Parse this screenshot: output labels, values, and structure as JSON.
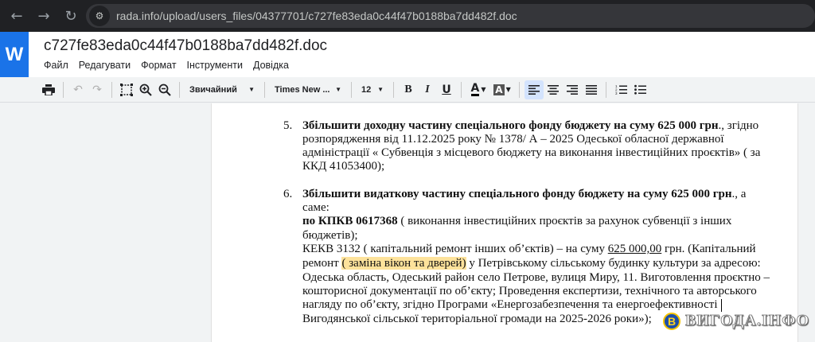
{
  "browser": {
    "back_icon": "←",
    "forward_icon": "→",
    "reload_icon": "↻",
    "site_info_icon": "⚙",
    "url": "rada.info/upload/users_files/04377701/c727fe83eda0c44f47b0188ba7dd482f.doc"
  },
  "app": {
    "logo_letter": "W",
    "doc_title": "c727fe83eda0c44f47b0188ba7dd482f.doc",
    "menu": [
      "Файл",
      "Редагувати",
      "Формат",
      "Інструменти",
      "Довідка"
    ]
  },
  "toolbar": {
    "style_select": "Звичайний",
    "font_select": "Times New ...",
    "size_select": "12",
    "bold": "B",
    "italic": "I",
    "underline": "U",
    "text_color": "A",
    "highlight_color": "A",
    "icons": [
      "print-icon",
      "undo-icon",
      "redo-icon",
      "select-all-icon",
      "zoom-in-icon",
      "zoom-out-icon",
      "align-left-icon",
      "align-center-icon",
      "align-right-icon",
      "align-justify-icon",
      "numbered-list-icon",
      "bulleted-list-icon"
    ]
  },
  "document": {
    "item5": {
      "number": "5.",
      "bold": "Збільшити доходну частину спеціального фонду бюджету на суму 625 000 грн",
      "line1_rest": "., згідно",
      "line2": "розпорядження  від 11.12.2025 року № 1378/ А – 2025 Одеської обласної державної",
      "line3": "адміністрації « Субвенція з місцевого бюджету на виконання інвестиційних проєктів» ( за",
      "line4": "ККД 41053400);"
    },
    "item6": {
      "number": "6.",
      "bold": "Збільшити видаткову частину спеціального фонду бюджету на суму 625 000 грн",
      "line1_rest": "., а",
      "line2": "саме:",
      "kpkv_bold": "по КПКВ 0617368",
      "kpkv_rest": " ( виконання інвестиційних проєктів за рахунок субвенції з інших",
      "line4": "бюджетів);",
      "kekv_start": "КЕКВ 3132 ( капітальний ремонт інших об’єктів) – на суму ",
      "kekv_amount": "625 000,00",
      "kekv_end": " грн. (Капітальний",
      "remont": "ремонт ",
      "highlight": "( заміна вікон та  дверей)",
      "after_highlight": " у Петрівському сільському будинку культури за адресою:",
      "line7": "Одеська область, Одеський район  село Петрове, вулиця Миру, 11. Виготовлення проєктно –",
      "line8": "кошторисної документації по об’єкту; Проведення експертизи, технічного та авторського",
      "line9": "нагляду по об’єкту, згідно Програми «Енергозабезпечення та енергоефективності",
      "line10": "Вигодянської сільської територіальної громади на 2025-2026 роки»);"
    }
  },
  "watermark": {
    "logo_letter": "В",
    "text": "ВИГОДА.ІНФО"
  },
  "colors": {
    "app_blue": "#1a73e8",
    "highlight": "#fde29b",
    "browser_dark": "#202124"
  }
}
